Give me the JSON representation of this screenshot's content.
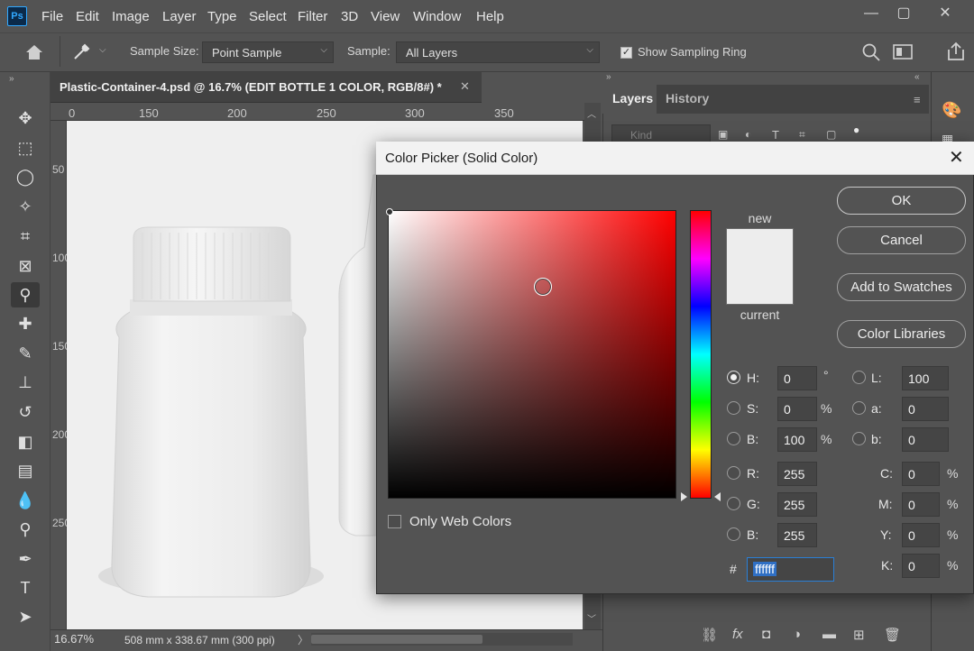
{
  "app": {
    "logo": "Ps"
  },
  "menu": [
    "File",
    "Edit",
    "Image",
    "Layer",
    "Type",
    "Select",
    "Filter",
    "3D",
    "View",
    "Window",
    "Help"
  ],
  "window_controls": {
    "minimize": "—",
    "maximize": "▢",
    "close": "✕"
  },
  "options": {
    "sample_size_label": "Sample Size:",
    "sample_size_value": "Point Sample",
    "sample_label": "Sample:",
    "sample_value": "All Layers",
    "show_ring_label": "Show Sampling Ring",
    "show_ring_checked": true
  },
  "document": {
    "tab_title": "Plastic-Container-4.psd @ 16.7% (EDIT BOTTLE 1 COLOR, RGB/8#) *",
    "ruler_top": [
      "0",
      "150",
      "200",
      "250",
      "300",
      "350"
    ],
    "ruler_left": [
      "50",
      "100",
      "150",
      "200",
      "250"
    ],
    "zoom": "16.67%",
    "doc_size": "508 mm x 338.67 mm (300 ppi)"
  },
  "panel": {
    "tabs": [
      "Layers",
      "History"
    ],
    "kind_placeholder": "Kind"
  },
  "dialog": {
    "title": "Color Picker (Solid Color)",
    "new_label": "new",
    "current_label": "current",
    "new_color": "#ededed",
    "buttons": {
      "ok": "OK",
      "cancel": "Cancel",
      "add_swatches": "Add to Swatches",
      "color_libraries": "Color Libraries"
    },
    "only_web_colors": "Only Web Colors",
    "hsb": {
      "h_label": "H:",
      "h": "0",
      "h_unit": "°",
      "s_label": "S:",
      "s": "0",
      "s_unit": "%",
      "b_label": "B:",
      "b": "100",
      "b_unit": "%"
    },
    "rgb": {
      "r_label": "R:",
      "r": "255",
      "g_label": "G:",
      "g": "255",
      "b_label": "B:",
      "b": "255"
    },
    "lab": {
      "l_label": "L:",
      "l": "100",
      "a_label": "a:",
      "a": "0",
      "b_label": "b:",
      "b": "0"
    },
    "cmyk": {
      "c_label": "C:",
      "c": "0",
      "m_label": "M:",
      "m": "0",
      "y_label": "Y:",
      "y": "0",
      "k_label": "K:",
      "k": "0",
      "unit": "%"
    },
    "hex_label": "#",
    "hex": "ffffff"
  }
}
